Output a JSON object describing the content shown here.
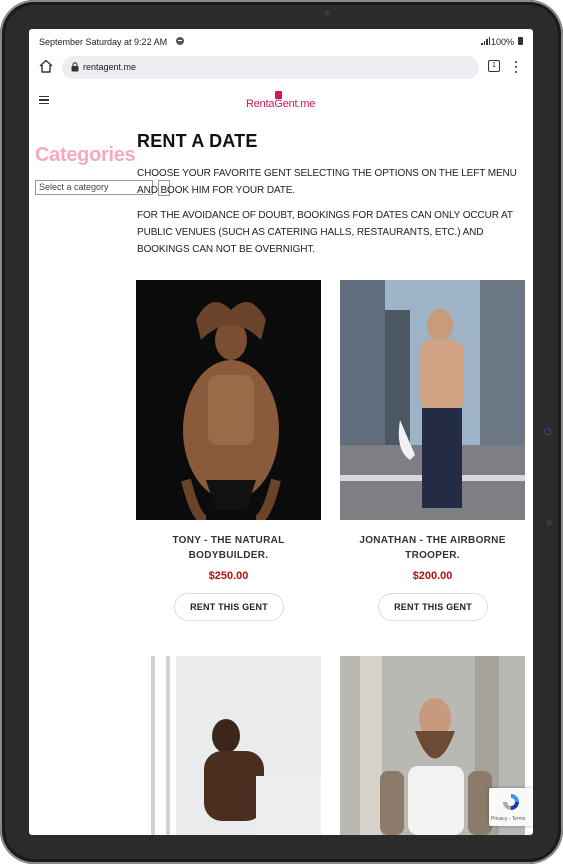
{
  "status_bar": {
    "time": "September Saturday at 9:22 AM",
    "battery": "100%"
  },
  "browser": {
    "url": "rentagent.me",
    "tab_count": "1"
  },
  "site": {
    "logo": "RentaGent.me",
    "brand_color": "#d4145a"
  },
  "sidebar": {
    "categories_title": "Categories",
    "select_placeholder": "Select a category"
  },
  "main": {
    "title": "RENT A DATE",
    "intro": "CHOOSE YOUR FAVORITE GENT SELECTING THE OPTIONS ON THE LEFT MENU AND BOOK HIM FOR YOUR DATE.",
    "notice": "FOR THE AVOIDANCE OF DOUBT, BOOKINGS FOR DATES CAN ONLY OCCUR AT PUBLIC VENUES (SUCH AS CATERING HALLS, RESTAURANTS, ETC.) AND BOOKINGS CAN NOT BE OVERNIGHT."
  },
  "products": [
    {
      "name": "TONY - THE NATURAL BODYBUILDER.",
      "price": "$250.00",
      "button": "RENT THIS GENT"
    },
    {
      "name": "JONATHAN - THE AIRBORNE TROOPER.",
      "price": "$200.00",
      "button": "RENT THIS GENT"
    }
  ],
  "recaptcha": {
    "text": "Privacy - Terms"
  },
  "colors": {
    "price": "#b01212",
    "categories_title": "#f5a9c4"
  },
  "icons": [
    "home-icon",
    "lock-icon",
    "tabs-icon",
    "menu-dots-icon",
    "hamburger-icon",
    "spotify-icon",
    "signal-icon",
    "battery-icon",
    "recaptcha-icon"
  ]
}
